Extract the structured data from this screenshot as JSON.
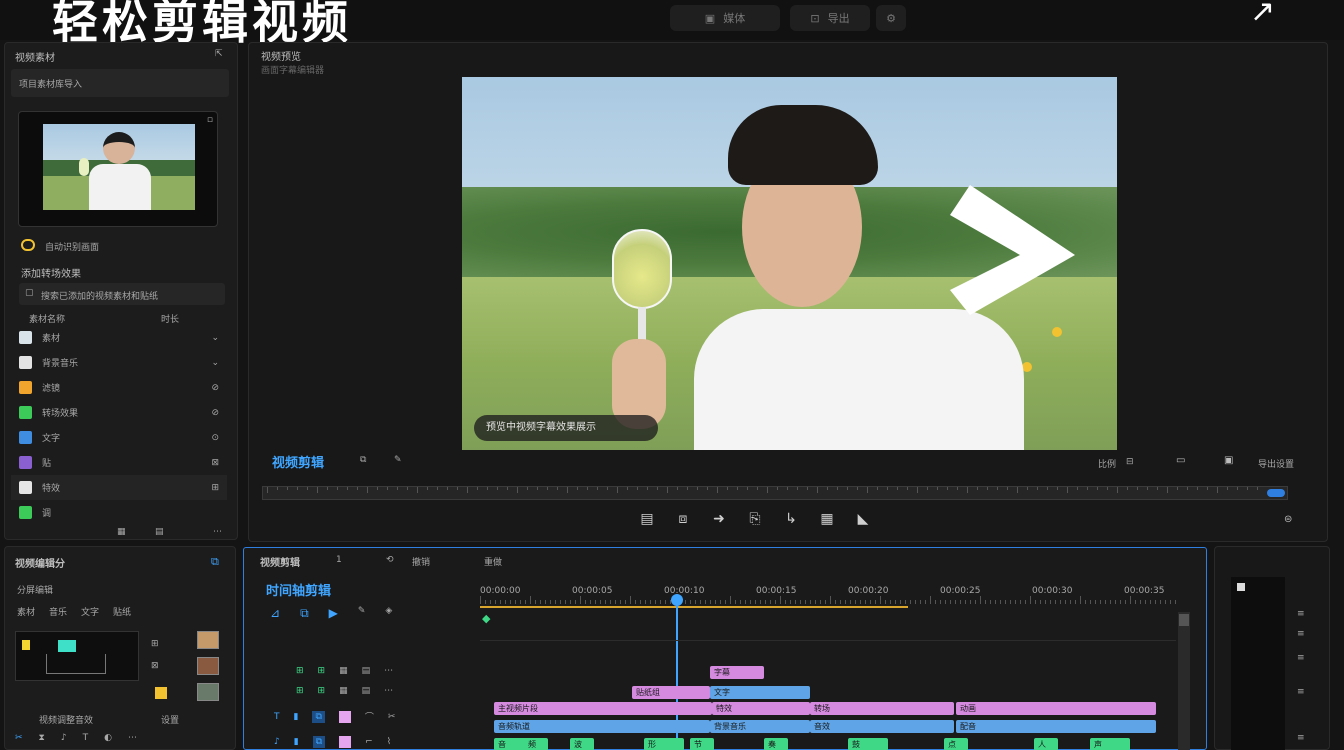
{
  "app": {
    "big_title": "轻松剪辑视频",
    "top_buttons": [
      {
        "icon": "image-icon",
        "label": "媒体"
      },
      {
        "icon": "export-icon",
        "label": "导出"
      },
      {
        "icon": "settings-icon",
        "label": ""
      }
    ],
    "corner_arrow": "↗"
  },
  "left_panel": {
    "header": "视频素材",
    "tab": "项目素材库导入",
    "thumb_caption": "自动识别画面",
    "section_title": "添加转场效果",
    "search_placeholder": "搜索已添加的视频素材和贴纸",
    "list_header_left": "素材名称",
    "list_header_right": "时长",
    "items": [
      {
        "label": "素材",
        "color": "#d9e4ea",
        "icon": "image-icon"
      },
      {
        "label": "背景音乐",
        "color": "#e3e3e3",
        "icon": "music-icon"
      },
      {
        "label": "滤镜",
        "color": "#f1a52c",
        "icon": "filter-icon"
      },
      {
        "label": "转场效果",
        "color": "#3ccb59",
        "icon": "transition-icon"
      },
      {
        "label": "文字",
        "color": "#3f8de0",
        "icon": "text-icon"
      },
      {
        "label": "贴",
        "color": "#8a5fd0",
        "icon": "sticker-icon"
      },
      {
        "label": "特效",
        "color": "#e6e6e6",
        "icon": "effect-icon"
      },
      {
        "label": "调",
        "color": "#3ccb59",
        "icon": "adjust-icon"
      }
    ]
  },
  "preview": {
    "title": "视频预览",
    "subtitle_bar": "画面字幕编辑器",
    "caption": "预览中视频字幕效果展示",
    "label": "视频剪辑",
    "right_label": "导出设置",
    "zoom_label": "比例",
    "controls": [
      "trim-icon",
      "crop-icon",
      "forward-icon",
      "split-icon",
      "rotate-icon",
      "mirror-icon",
      "play-icon"
    ]
  },
  "bottom_left": {
    "title": "视频编辑分",
    "subtitle": "分屏编辑",
    "tabs": [
      "素材",
      "音乐",
      "文字",
      "贴纸"
    ],
    "footer": "视频调整音效",
    "footer_right": "设置"
  },
  "timeline": {
    "title": "视频剪辑",
    "title_badge": "1",
    "actions": [
      "撤销",
      "重做"
    ],
    "section": "时间轴剪辑",
    "ruler_labels": [
      "00:00:00",
      "00:00:05",
      "00:00:10",
      "00:00:15",
      "00:00:20",
      "00:00:25",
      "00:00:30",
      "00:00:35"
    ],
    "track_clips": [
      {
        "row": 0,
        "label": "字幕",
        "color": "pink"
      },
      {
        "row": 1,
        "label": "贴纸组",
        "color": "pink"
      },
      {
        "row": 1,
        "label": "文字",
        "color": "blue"
      },
      {
        "row": 2,
        "label": "主视频片段",
        "color": "pink"
      },
      {
        "row": 2,
        "label": "特效",
        "color": "pink"
      },
      {
        "row": 2,
        "label": "转场",
        "color": "pink"
      },
      {
        "row": 2,
        "label": "动画",
        "color": "pink"
      },
      {
        "row": 3,
        "label": "音频轨道",
        "color": "blue"
      },
      {
        "row": 3,
        "label": "背景音乐",
        "color": "blue"
      },
      {
        "row": 3,
        "label": "音效",
        "color": "blue"
      },
      {
        "row": 3,
        "label": "配音",
        "color": "blue"
      }
    ],
    "green_clips": [
      "音",
      "频",
      "波",
      "形",
      "节",
      "奏",
      "鼓",
      "点",
      "人",
      "声"
    ]
  }
}
